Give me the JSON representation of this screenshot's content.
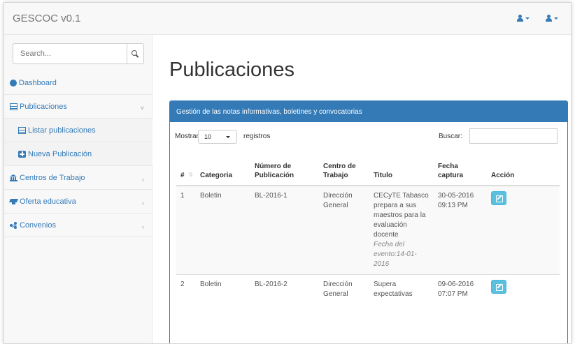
{
  "app": {
    "brand": "GESCOC v0.1"
  },
  "sidebar": {
    "search_placeholder": "Search...",
    "items": [
      {
        "label": "Dashboard",
        "icon": "dashboard-icon"
      },
      {
        "label": "Publicaciones",
        "icon": "table-icon",
        "arrow": "˅"
      },
      {
        "label": "Listar publicaciones",
        "icon": "table-icon"
      },
      {
        "label": "Nueva Publicación",
        "icon": "plus-square-icon"
      },
      {
        "label": "Centros de Trabajo",
        "icon": "bank-icon",
        "arrow": "‹"
      },
      {
        "label": "Oferta educativa",
        "icon": "graduation-cap-icon",
        "arrow": "‹"
      },
      {
        "label": "Convenios",
        "icon": "share-icon",
        "arrow": "‹"
      }
    ]
  },
  "main": {
    "title": "Publicaciones",
    "panel_heading": "Gestión de las notas informativas, boletines y convocatorias",
    "show_label": "Mostrar",
    "page_size": "10",
    "records_label": "registros",
    "search_label": "Buscar:",
    "table": {
      "headers": [
        "#",
        "Categoria",
        "Número de Publicación",
        "Centro de Trabajo",
        "Titulo",
        "Fecha captura",
        "Acción"
      ],
      "rows": [
        {
          "num": "1",
          "categoria": "Boletin",
          "numero": "BL-2016-1",
          "centro": "Dirección General",
          "titulo": "CECyTE Tabasco prepara a sus maestros para la evaluación docente",
          "evento": "Fecha del evento:14-01-2016",
          "fecha": "30-05-2016 09:13 PM"
        },
        {
          "num": "2",
          "categoria": "Boletin",
          "numero": "BL-2016-2",
          "centro": "Dirección General",
          "titulo": "Supera expectativas",
          "evento": "",
          "fecha": "09-06-2016 07:07 PM"
        }
      ]
    }
  },
  "colors": {
    "primary": "#337ab7",
    "info": "#5bc0de"
  }
}
